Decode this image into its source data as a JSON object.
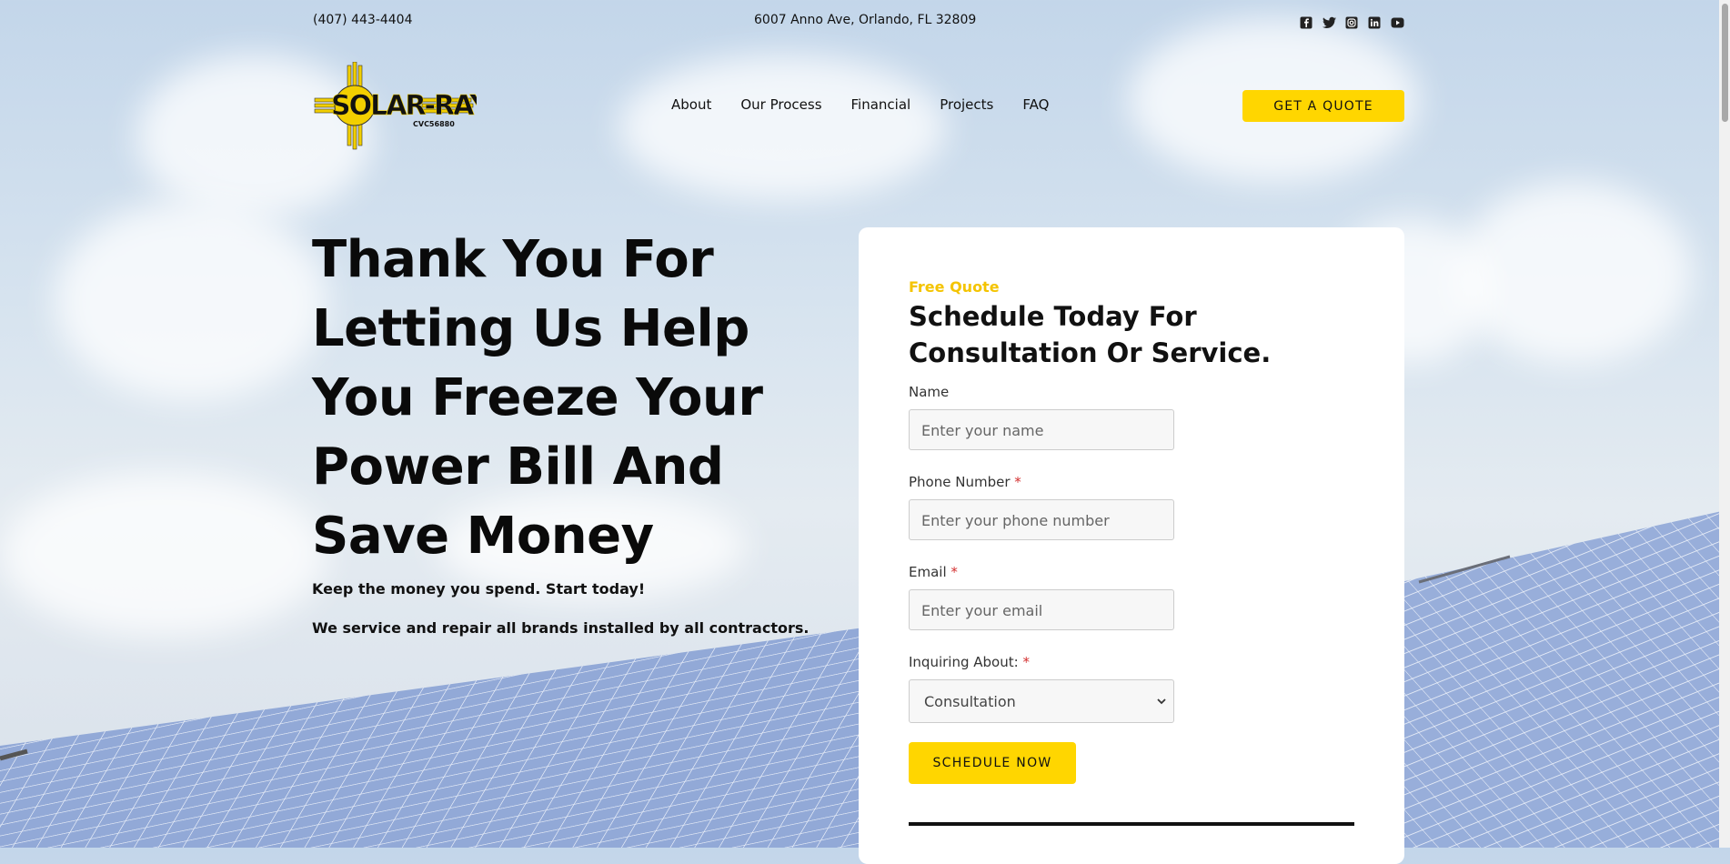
{
  "topbar": {
    "phone": "(407) 443-4404",
    "address": "6007 Anno Ave, Orlando, FL 32809",
    "social": [
      "facebook-icon",
      "twitter-icon",
      "instagram-icon",
      "linkedin-icon",
      "youtube-icon"
    ]
  },
  "nav": {
    "logo_text": "SOLAR-RAY",
    "logo_sub": "CVC56880",
    "items": [
      {
        "label": "About"
      },
      {
        "label": "Our Process"
      },
      {
        "label": "Financial"
      },
      {
        "label": "Projects"
      },
      {
        "label": "FAQ"
      }
    ],
    "quote_button": "GET A QUOTE"
  },
  "hero": {
    "title": "Thank You For Letting Us Help You Freeze Your Power Bill And Save Money",
    "line1": "Keep the money you spend. Start today!",
    "line2": "We service and repair all brands installed by all contractors."
  },
  "form": {
    "kicker": "Free Quote",
    "title": "Schedule Today For Consultation Or Service.",
    "name_label": "Name",
    "name_placeholder": "Enter your name",
    "phone_label": "Phone Number",
    "phone_placeholder": "Enter your phone number",
    "email_label": "Email",
    "email_placeholder": "Enter your email",
    "inquiry_label": "Inquiring About:",
    "inquiry_value": "Consultation",
    "required_mark": "*",
    "submit": "SCHEDULE NOW"
  },
  "colors": {
    "accent": "#ffd600",
    "kicker": "#f4c400",
    "required": "#d32f2f"
  }
}
